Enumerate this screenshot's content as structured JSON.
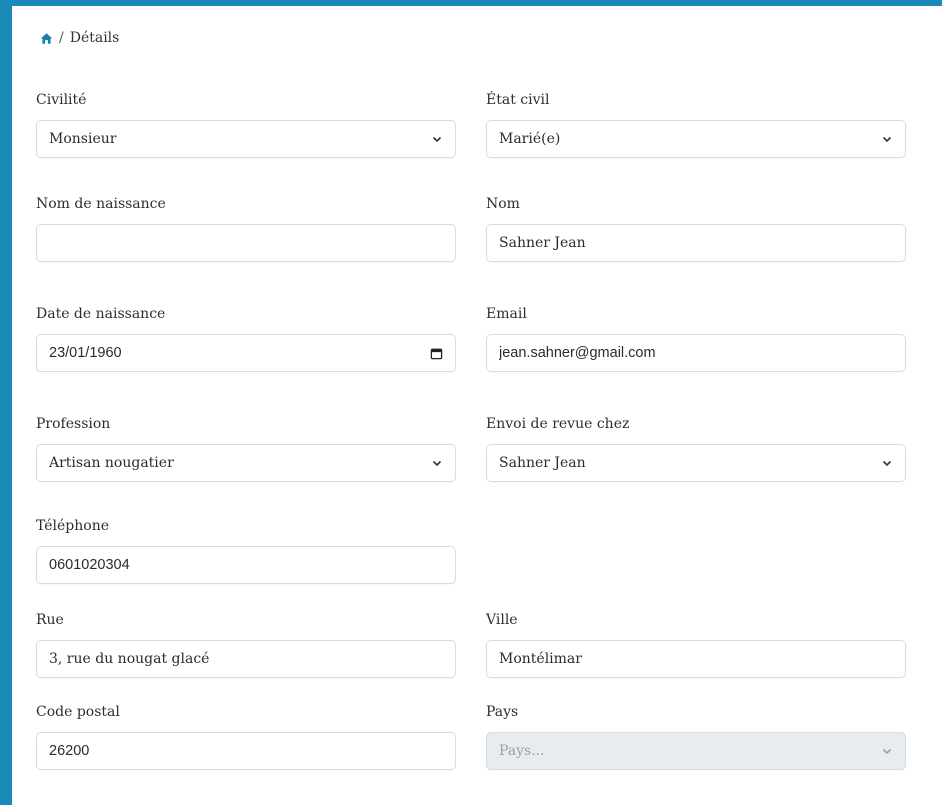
{
  "breadcrumb": {
    "current": "Détails",
    "separator": "/"
  },
  "form": {
    "civilite": {
      "label": "Civilité",
      "value": "Monsieur"
    },
    "etat_civil": {
      "label": "État civil",
      "value": "Marié(e)"
    },
    "nom_naissance": {
      "label": "Nom de naissance",
      "value": ""
    },
    "nom": {
      "label": "Nom",
      "value": "Sahner Jean"
    },
    "date_naissance": {
      "label": "Date de naissance",
      "value": "23/01/1960"
    },
    "email": {
      "label": "Email",
      "value": "jean.sahner@gmail.com"
    },
    "profession": {
      "label": "Profession",
      "value": "Artisan nougatier"
    },
    "envoi_revue": {
      "label": "Envoi de revue chez",
      "value": "Sahner Jean"
    },
    "telephone": {
      "label": "Téléphone",
      "value": "0601020304"
    },
    "rue": {
      "label": "Rue",
      "value": "3, rue du nougat glacé"
    },
    "ville": {
      "label": "Ville",
      "value": "Montélimar"
    },
    "code_postal": {
      "label": "Code postal",
      "value": "26200"
    },
    "pays": {
      "label": "Pays",
      "placeholder": "Pays..."
    }
  },
  "icons": {
    "home": "home-icon",
    "select": "chevron-down-icon",
    "date": "calendar-icon"
  },
  "colors": {
    "background": "#1a8ab8",
    "panel": "#ffffff",
    "border": "#d9dcdf",
    "disabled": "#e9ecef",
    "home_icon": "#1a7fb0"
  }
}
